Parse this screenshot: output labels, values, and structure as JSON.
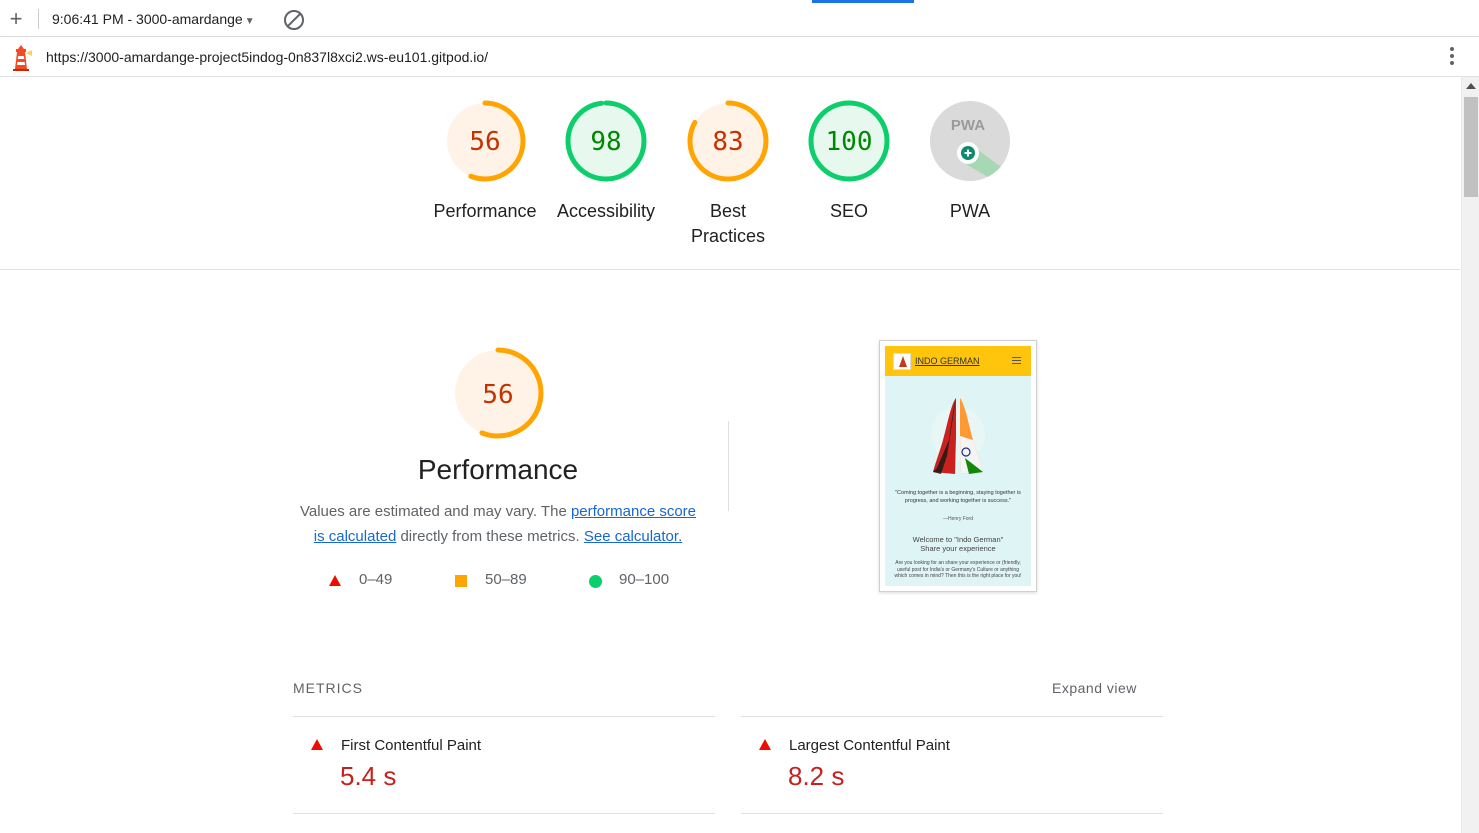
{
  "toolbar": {
    "new_label": "+",
    "report_selector": "9:06:41 PM - 3000-amardange",
    "report_caret": "▼"
  },
  "urlbar": {
    "url": "https://3000-amardange-project5indog-0n837l8xci2.ws-eu101.gitpod.io/"
  },
  "colors": {
    "fail": "#eb0f00",
    "average": "#ffa400",
    "pass": "#0cce6b",
    "average_fill": "#fff3e8",
    "pass_fill": "#e7f8ee",
    "average_text": "#c33300",
    "pass_text": "#008800"
  },
  "gauges": [
    {
      "label": "Performance",
      "score": 56,
      "rating": "average"
    },
    {
      "label": "Accessibility",
      "score": 98,
      "rating": "pass"
    },
    {
      "label": "Best Practices",
      "score": 83,
      "rating": "average"
    },
    {
      "label": "SEO",
      "score": 100,
      "rating": "pass"
    },
    {
      "label": "PWA",
      "score": null,
      "rating": "pwa",
      "badge_text": "PWA"
    }
  ],
  "performance": {
    "score": 56,
    "title": "Performance",
    "desc_prefix": "Values are estimated and may vary. The ",
    "desc_link1": "performance score is calculated",
    "desc_middle": " directly from these metrics. ",
    "desc_link2": "See calculator.",
    "legend": [
      {
        "range": "0–49",
        "icon": "fail-triangle-icon"
      },
      {
        "range": "50–89",
        "icon": "average-square-icon"
      },
      {
        "range": "90–100",
        "icon": "pass-circle-icon"
      }
    ]
  },
  "screenshot_preview": {
    "brand": "INDO GERMAN",
    "quote": "\"Coming together is a beginning, staying together is progress, and working together is success.\"",
    "author": "—Henry Ford",
    "welcome_line1": "Welcome to \"Indo German\"",
    "welcome_line2": "Share your experience",
    "body": "Are you looking for an share your experience or (friendly, useful post for India's or Germany's Culture or anything which comes in mind? Then this is the right place for you!"
  },
  "metrics": {
    "header": "METRICS",
    "expand_label": "Expand view",
    "items": [
      {
        "label": "First Contentful Paint",
        "value": "5.4 s",
        "rating": "fail"
      },
      {
        "label": "Largest Contentful Paint",
        "value": "8.2 s",
        "rating": "fail"
      }
    ]
  }
}
